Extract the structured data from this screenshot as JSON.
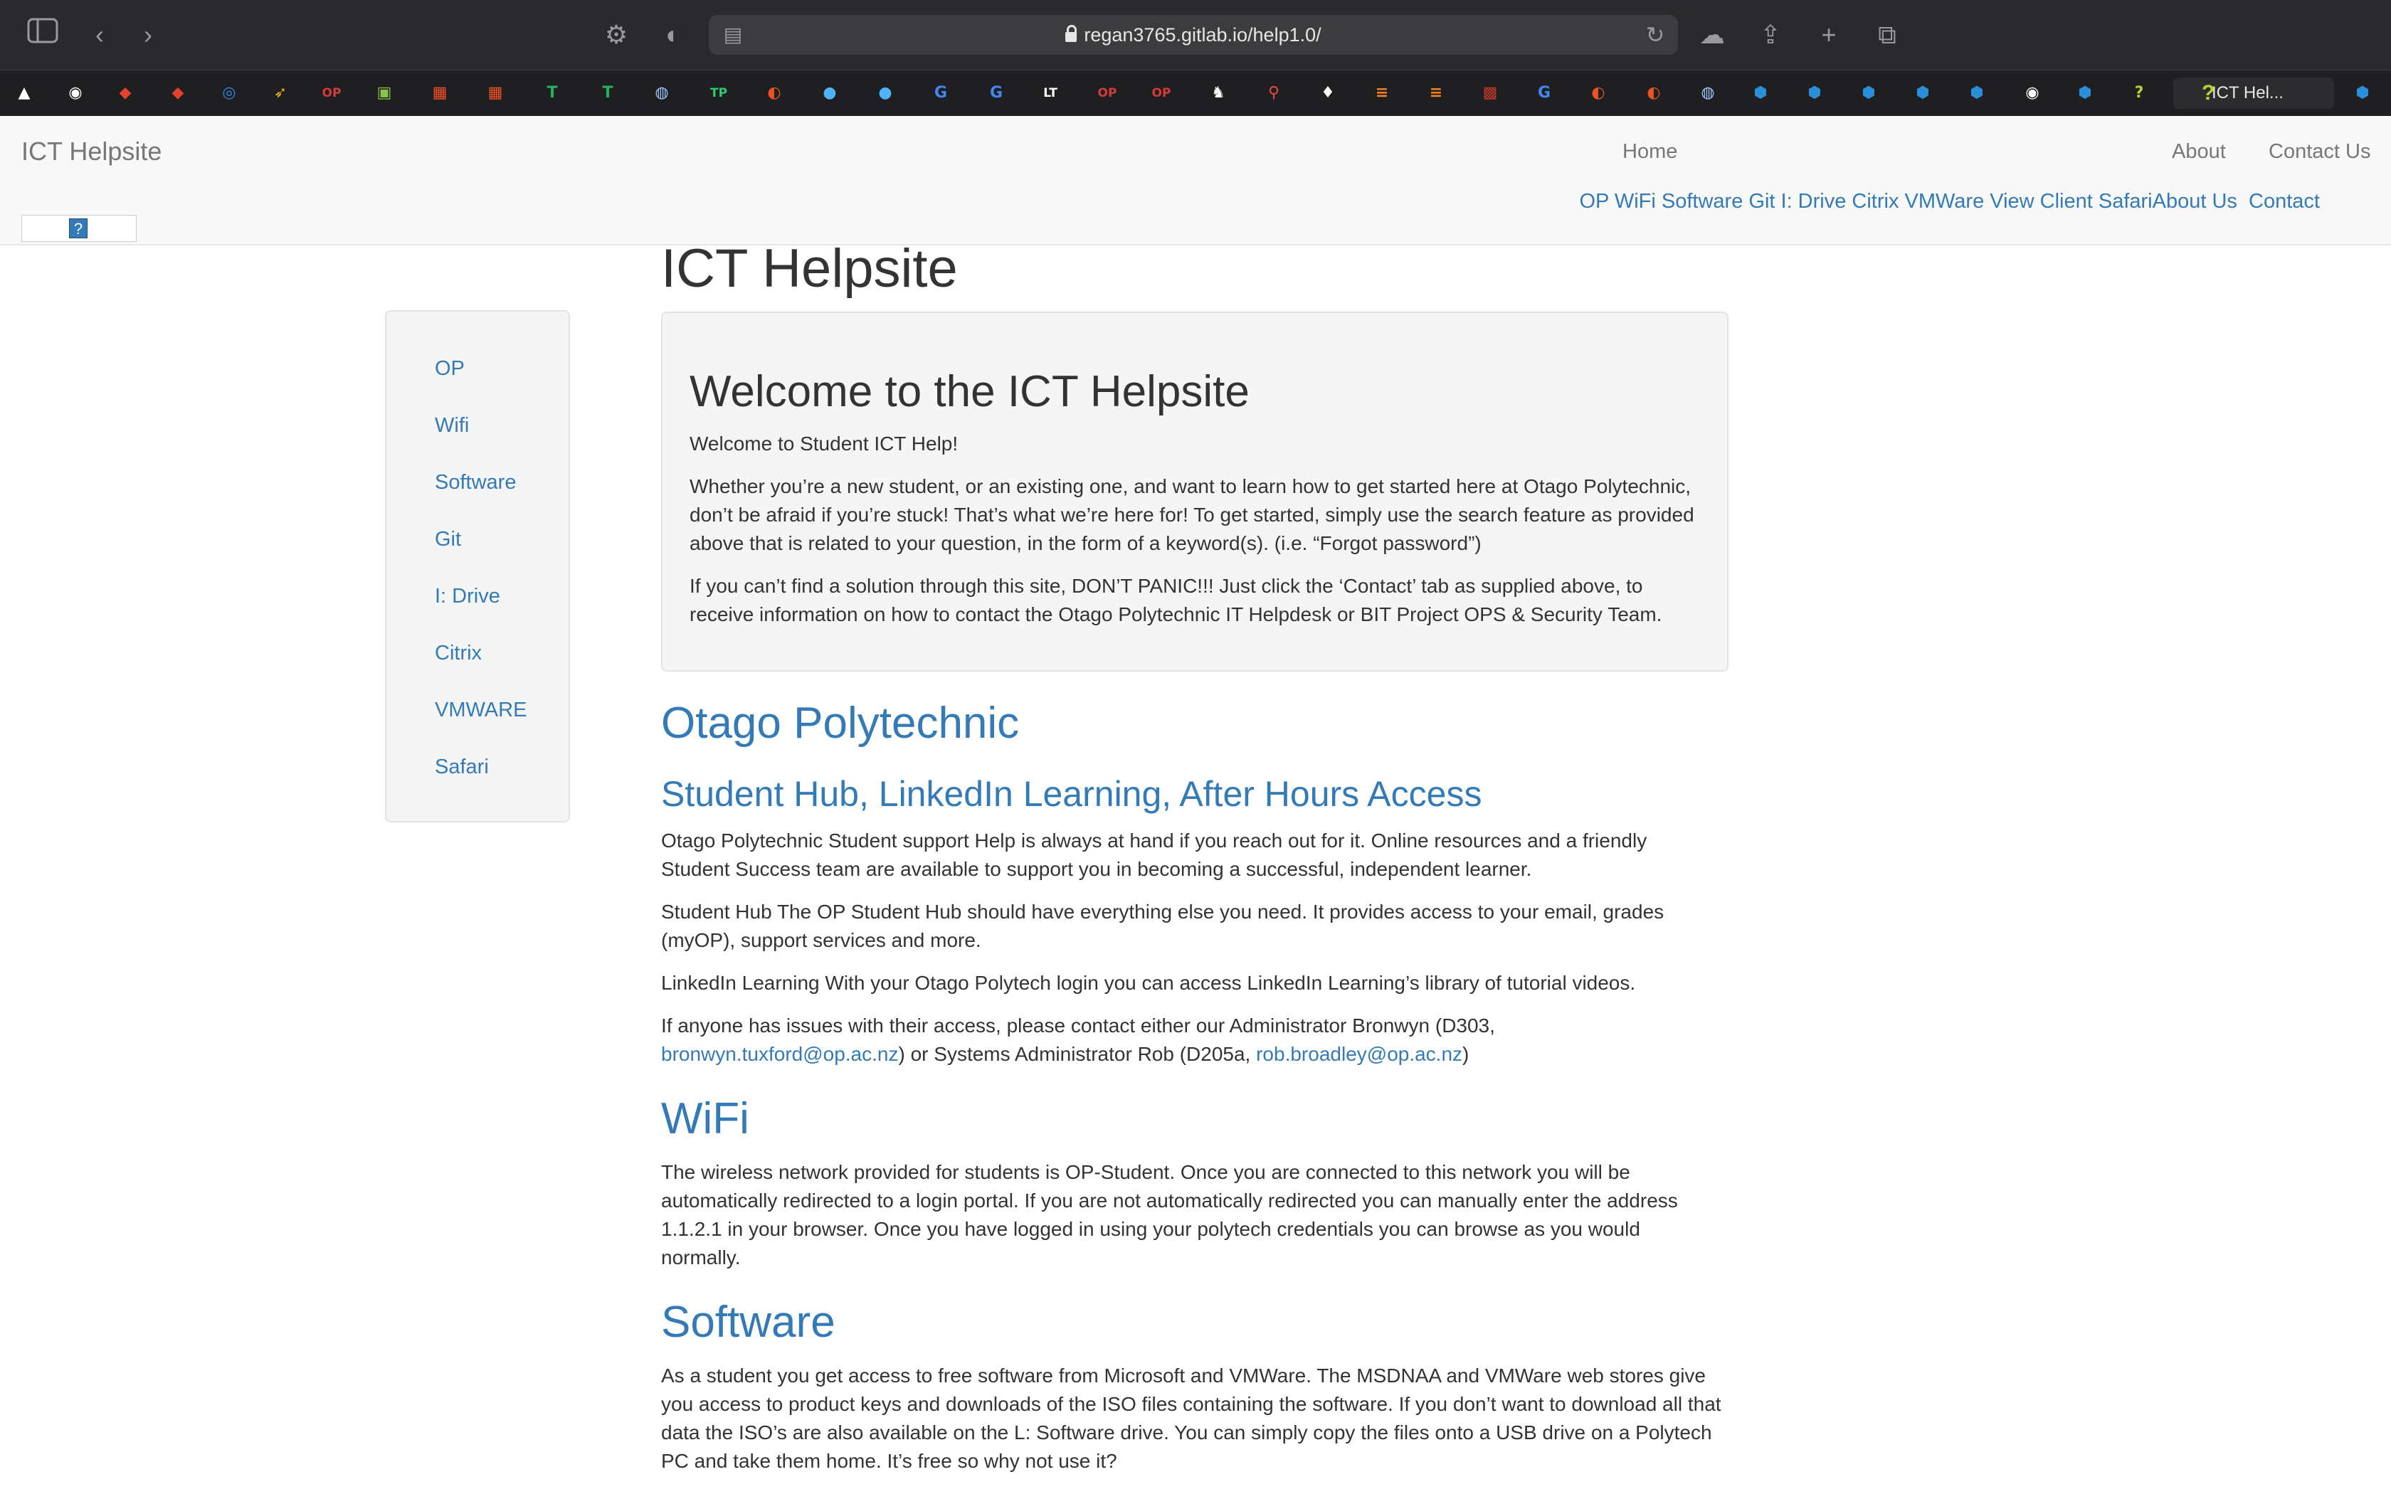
{
  "browser": {
    "url": "regan3765.gitlab.io/help1.0/",
    "active_bookmark": "ICT Hel..."
  },
  "bookmarks": [
    {
      "icon": "a-logo-icon",
      "glyph": "▲",
      "color": "#ffffff"
    },
    {
      "icon": "github-icon",
      "glyph": "◉",
      "color": "#ffffff"
    },
    {
      "icon": "gitlab-icon",
      "glyph": "◆",
      "color": "#e2432a"
    },
    {
      "icon": "gitlab-icon",
      "glyph": "◆",
      "color": "#e2432a"
    },
    {
      "icon": "ring-icon",
      "glyph": "◎",
      "color": "#2f8be0"
    },
    {
      "icon": "bird-icon",
      "glyph": "➶",
      "color": "#f2b01e"
    },
    {
      "icon": "op-icon",
      "glyph": "OP",
      "color": "#d33a3a"
    },
    {
      "icon": "green-icon",
      "glyph": "▣",
      "color": "#8bc34a"
    },
    {
      "icon": "microsoft-icon",
      "glyph": "▦",
      "color": "#f25022"
    },
    {
      "icon": "microsoft-icon",
      "glyph": "▦",
      "color": "#f25022"
    },
    {
      "icon": "t-icon",
      "glyph": "T",
      "color": "#27ae60"
    },
    {
      "icon": "t-icon",
      "glyph": "T",
      "color": "#27ae60"
    },
    {
      "icon": "globe-icon",
      "glyph": "◍",
      "color": "#9ec9ff"
    },
    {
      "icon": "tp-icon",
      "glyph": "TP",
      "color": "#2ecc71"
    },
    {
      "icon": "ubuntu-icon",
      "glyph": "◐",
      "color": "#e95420"
    },
    {
      "icon": "chat-icon",
      "glyph": "●",
      "color": "#4fb3f6"
    },
    {
      "icon": "chat-icon",
      "glyph": "●",
      "color": "#4fb3f6"
    },
    {
      "icon": "google-icon",
      "glyph": "G",
      "color": "#4285f4"
    },
    {
      "icon": "google-icon",
      "glyph": "G",
      "color": "#4285f4"
    },
    {
      "icon": "lt-icon",
      "glyph": "LT",
      "color": "#ffffff"
    },
    {
      "icon": "op-icon",
      "glyph": "OP",
      "color": "#d33a3a"
    },
    {
      "icon": "op-icon",
      "glyph": "OP",
      "color": "#d33a3a"
    },
    {
      "icon": "linux-icon",
      "glyph": "♞",
      "color": "#ffffff"
    },
    {
      "icon": "pin-icon",
      "glyph": "⚲",
      "color": "#e74c3c"
    },
    {
      "icon": "bulb-icon",
      "glyph": "♦",
      "color": "#ffffff"
    },
    {
      "icon": "stack-icon",
      "glyph": "≡",
      "color": "#f48024"
    },
    {
      "icon": "stack-icon",
      "glyph": "≡",
      "color": "#f48024"
    },
    {
      "icon": "photo-icon",
      "glyph": "▩",
      "color": "#c0392b"
    },
    {
      "icon": "google-icon",
      "glyph": "G",
      "color": "#4285f4"
    },
    {
      "icon": "ubuntu-icon",
      "glyph": "◐",
      "color": "#e95420"
    },
    {
      "icon": "ubuntu-icon",
      "glyph": "◐",
      "color": "#e95420"
    },
    {
      "icon": "globe-icon",
      "glyph": "◍",
      "color": "#9ec9ff"
    },
    {
      "icon": "hex-icon",
      "glyph": "⬢",
      "color": "#2a8fd8"
    },
    {
      "icon": "hex-icon",
      "glyph": "⬢",
      "color": "#2a8fd8"
    },
    {
      "icon": "hex-icon",
      "glyph": "⬢",
      "color": "#2a8fd8"
    },
    {
      "icon": "hex-icon",
      "glyph": "⬢",
      "color": "#2a8fd8"
    },
    {
      "icon": "hex-icon",
      "glyph": "⬢",
      "color": "#2a8fd8"
    },
    {
      "icon": "github-icon",
      "glyph": "◉",
      "color": "#ffffff"
    },
    {
      "icon": "hex-icon",
      "glyph": "⬢",
      "color": "#2a8fd8"
    },
    {
      "icon": "question-icon",
      "glyph": "?",
      "color": "#b5d333"
    }
  ],
  "site": {
    "brand": "ICT Helpsite",
    "nav": {
      "home": "Home",
      "about": "About",
      "contact": "Contact Us",
      "sub_links": "OP WiFi Software Git I: Drive Citrix VMWare View Client SafariAbout Us",
      "sub_contact": "Contact",
      "widget_glyph": "?"
    },
    "page_title": "ICT Helpsite",
    "sidebar": [
      "OP",
      "Wifi",
      "Software",
      "Git",
      "I: Drive",
      "Citrix",
      "VMWARE",
      "Safari"
    ],
    "welcome": {
      "heading": "Welcome to the ICT Helpsite",
      "p1": "Welcome to Student ICT Help!",
      "p2": "Whether you’re a new student, or an existing one, and want to learn how to get started here at Otago Polytechnic, don’t be afraid if you’re stuck! That’s what we’re here for! To get started, simply use the search feature as provided above that is related to your question, in the form of a keyword(s). (i.e. “Forgot password”)",
      "p3": "If you can’t find a solution through this site, DON’T PANIC!!! Just click the ‘Contact’ tab as supplied above, to receive information on how to contact the Otago Polytechnic IT Helpdesk or BIT Project OPS & Security Team."
    },
    "op": {
      "heading": "Otago Polytechnic",
      "subheading": "Student Hub, LinkedIn Learning, After Hours Access",
      "p1": "Otago Polytechnic Student support Help is always at hand if you reach out for it. Online resources and a friendly Student Success team are available to support you in becoming a successful, independent learner.",
      "p2": "Student Hub The OP Student Hub should have everything else you need. It provides access to your email, grades (myOP), support services and more.",
      "p3": "LinkedIn Learning With your Otago Polytech login you can access LinkedIn Learning’s library of tutorial videos.",
      "p4_a": "If anyone has issues with their access, please contact either our Administrator Bronwyn (D303,",
      "p4_email1": "bronwyn.tuxford@op.ac.nz",
      "p4_b": ") or Systems Administrator Rob (D205a,",
      "p4_email2": "rob.broadley@op.ac.nz",
      "p4_c": ")"
    },
    "wifi": {
      "heading": "WiFi",
      "p1": "The wireless network provided for students is OP-Student. Once you are connected to this network you will be automatically redirected to a login portal. If you are not automatically redirected you can manually enter the address 1.1.2.1 in your browser. Once you have logged in using your polytech credentials you can browse as you would normally."
    },
    "software": {
      "heading": "Software",
      "p1": "As a student you get access to free software from Microsoft and VMWare. The MSDNAA and VMWare web stores give you access to product keys and downloads of the ISO files containing the software. If you don’t want to download all that data the ISO’s are also available on the L: Software drive. You can simply copy the files onto a USB drive on a Polytech PC and take them home. It’s free so why not use it?"
    }
  }
}
